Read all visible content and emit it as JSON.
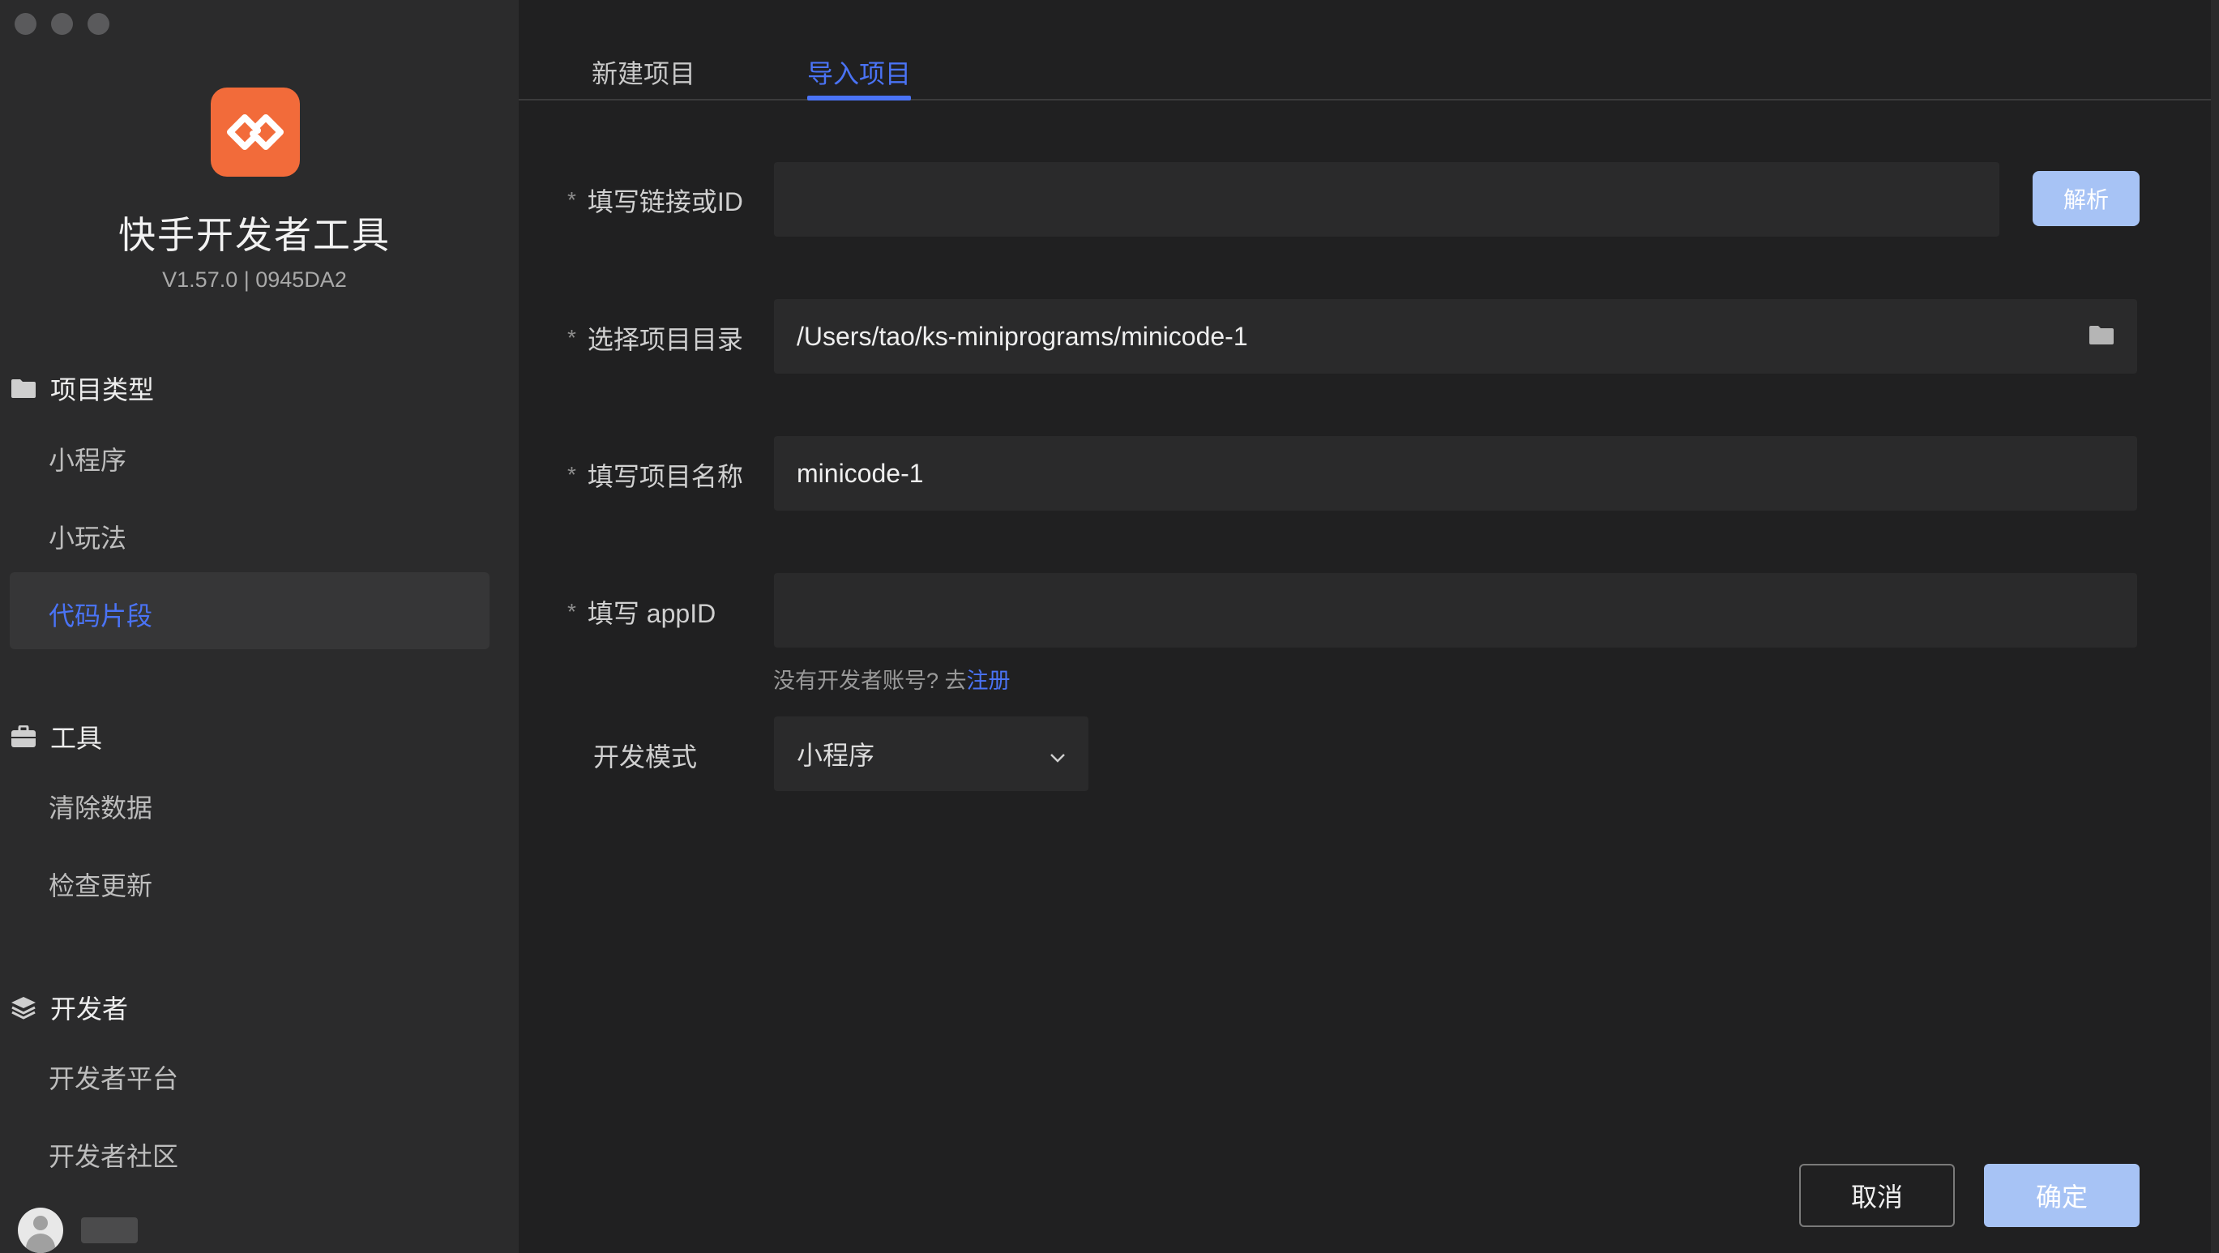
{
  "window": {
    "traffic_lights": [
      "close",
      "minimize",
      "maximize"
    ]
  },
  "sidebar": {
    "app_title": "快手开发者工具",
    "app_version": "V1.57.0 | 0945DA2",
    "logo_icon": "kuaishou-dev-logo-icon",
    "sections": [
      {
        "title": "项目类型",
        "icon": "folder-icon",
        "items": [
          "小程序",
          "小玩法",
          "代码片段"
        ],
        "active": "代码片段"
      },
      {
        "title": "工具",
        "icon": "toolbox-icon",
        "items": [
          "清除数据",
          "检查更新"
        ]
      },
      {
        "title": "开发者",
        "icon": "layers-icon",
        "items": [
          "开发者平台",
          "开发者社区"
        ]
      }
    ]
  },
  "tabs": [
    {
      "label": "新建项目",
      "active": false
    },
    {
      "label": "导入项目",
      "active": true
    }
  ],
  "form": {
    "link_label": "填写链接或ID",
    "link_value": "",
    "parse_button": "解析",
    "dir_label": "选择项目目录",
    "dir_value": "/Users/tao/ks-miniprograms/minicode-1",
    "name_label": "填写项目名称",
    "name_value": "minicode-1",
    "appid_label": "填写 appID",
    "appid_value": "",
    "hint_text": "没有开发者账号? 去",
    "hint_link": "注册",
    "mode_label": "开发模式",
    "mode_value": "小程序",
    "required_mark": "*"
  },
  "footer": {
    "cancel": "取消",
    "confirm": "确定"
  },
  "colors": {
    "accent": "#4a73f5",
    "logo": "#f26b3a",
    "button_disabled": "#a7c3f5"
  }
}
